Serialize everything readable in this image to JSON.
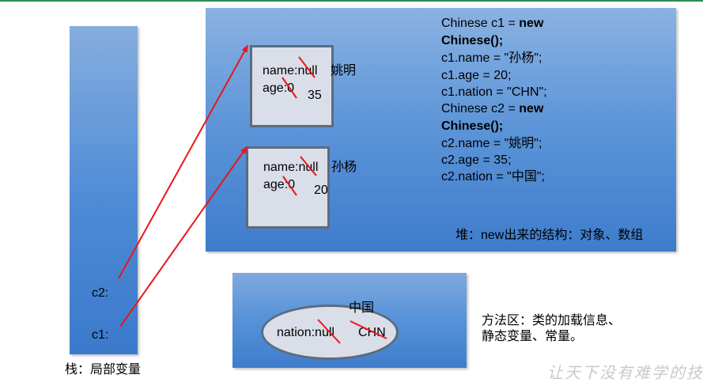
{
  "stack": {
    "label": "栈：局部变量",
    "c2": "c2:",
    "c1": "c1:"
  },
  "heap": {
    "label": "堆：new出来的结构：对象、数组",
    "object1": {
      "name_line": "name:null",
      "name_new": "姚明",
      "age_line": "age:0",
      "age_new": "35"
    },
    "object2": {
      "name_line": "name:null",
      "name_new": "孙杨",
      "age_line": "age:0",
      "age_new": "20"
    },
    "code": [
      {
        "text": "Chinese c1 = ",
        "bold": "new"
      },
      {
        "text": "",
        "bold": "Chinese();"
      },
      {
        "text": "c1.name = \"孙杨\";",
        "bold": ""
      },
      {
        "text": "c1.age = 20;",
        "bold": ""
      },
      {
        "text": "c1.nation = \"CHN\";",
        "bold": ""
      },
      {
        "text": "Chinese c2 = ",
        "bold": "new"
      },
      {
        "text": "",
        "bold": "Chinese();"
      },
      {
        "text": "c2.name = \"姚明\";",
        "bold": ""
      },
      {
        "text": "c2.age = 35;",
        "bold": ""
      },
      {
        "text": "c2.nation = \"中国\";",
        "bold": ""
      }
    ]
  },
  "method_area": {
    "label_line1": "方法区：类的加载信息、",
    "label_line2": "静态变量、常量。",
    "static_field": "nation:null",
    "value_old": "CHN",
    "value_new": "中国"
  },
  "watermark": "让天下没有难学的技术",
  "colors": {
    "arrow": "#e8161b",
    "strike": "#e8161b"
  }
}
